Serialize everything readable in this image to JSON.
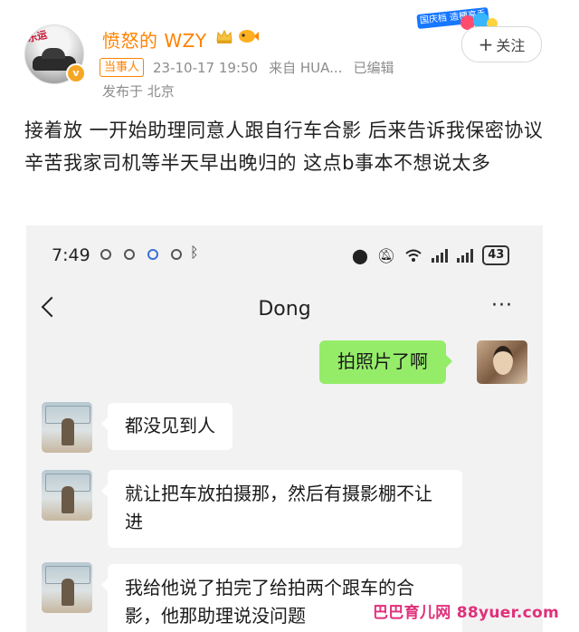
{
  "post": {
    "author": "愤怒的 WZY",
    "tag": "当事人",
    "time": "23-10-17 19:50",
    "source": "来自 HUA...",
    "edited": "已编辑",
    "location": "发布于 北京",
    "follow_label": "关注",
    "follow_icon": "plus-icon",
    "promo_text": "国庆档 造梗高手",
    "body": "接着放 一开始助理同意人跟自行车合影 后来告诉我保密协议 辛苦我家司机等半天早出晚归的 这点b事本不想说太多",
    "badge_colors": {
      "username": "#ff8200",
      "verified": "#f5a623"
    }
  },
  "screenshot": {
    "status_bar": {
      "time": "7:49",
      "battery": "43"
    },
    "chat": {
      "title": "Dong",
      "more_label": "···",
      "messages": [
        {
          "from": "me",
          "text": "拍照片了啊"
        },
        {
          "from": "other",
          "text": "都没见到人"
        },
        {
          "from": "other",
          "text": "就让把车放拍摄那，然后有摄影棚不让进"
        },
        {
          "from": "other",
          "text": "我给他说了拍完了给拍两个跟车的合影，他那助理说没问题"
        }
      ],
      "colors": {
        "outgoing": "#95ec69",
        "incoming": "#ffffff",
        "background": "#f2f2f2"
      }
    }
  },
  "watermark": "巴巴育儿网 88yuer.com"
}
